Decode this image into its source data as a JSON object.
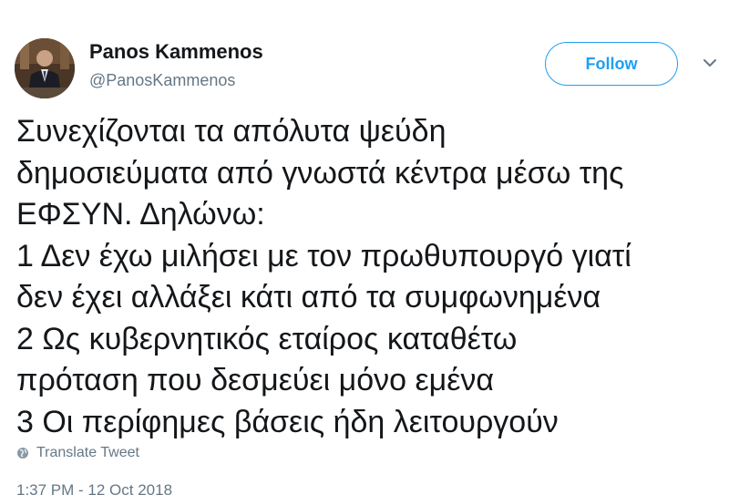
{
  "author": {
    "name": "Panos Kammenos",
    "handle": "@PanosKammenos"
  },
  "actions": {
    "follow_label": "Follow",
    "menu_icon": "chevron-down-icon"
  },
  "tweet": {
    "lines": [
      "Συνεχίζονται τα απόλυτα ψεύδη",
      "δημοσιεύματα από γνωστά κέντρα μέσω της",
      "ΕΦΣΥΝ. Δηλώνω:",
      "1 Δεν έχω μιλήσει με τον πρωθυπουργό γιατί",
      "δεν έχει αλλάξει κάτι από τα συμφωνημένα",
      "2 Ως κυβερνητικός εταίρος καταθέτω",
      "πρόταση που δεσμεύει μόνο εμένα",
      "3 Οι περίφημες βάσεις ήδη λειτουργούν"
    ],
    "translate_label": "Translate Tweet",
    "translate_icon": "globe-icon",
    "timestamp": "1:37 PM - 12 Oct 2018"
  },
  "colors": {
    "accent": "#1da1f2",
    "text_primary": "#14171a",
    "text_secondary": "#657786"
  }
}
